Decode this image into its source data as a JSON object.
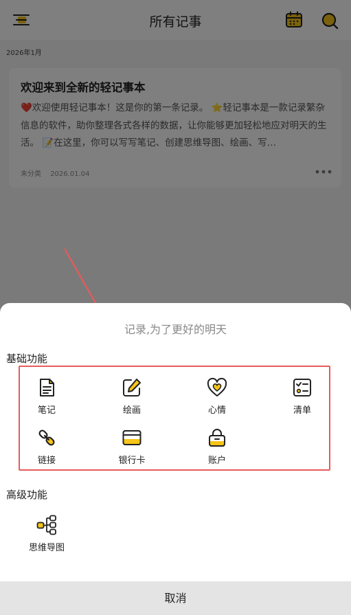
{
  "header": {
    "title": "所有记事",
    "menu_icon": "menu-icon",
    "calendar_icon": "calendar-icon",
    "search_icon": "search-icon"
  },
  "list": {
    "month": "2026年1月",
    "note": {
      "title": "欢迎来到全新的轻记事本",
      "body": "❤️欢迎使用轻记事本！这是你的第一条记录。 ⭐轻记事本是一款记录繁杂信息的软件，助你整理各式各样的数据，让你能够更加轻松地应对明天的生活。 📝在这里，你可以写写笔记、创建思维导图、绘画、写…",
      "category": "未分类",
      "date": "2026.01.04"
    }
  },
  "sheet": {
    "title": "记录,为了更好的明天",
    "basic_label": "基础功能",
    "basic_items": [
      {
        "label": "笔记",
        "icon": "note-icon"
      },
      {
        "label": "绘画",
        "icon": "draw-icon"
      },
      {
        "label": "心情",
        "icon": "mood-icon"
      },
      {
        "label": "清单",
        "icon": "checklist-icon"
      },
      {
        "label": "链接",
        "icon": "link-icon"
      },
      {
        "label": "银行卡",
        "icon": "bank-card-icon"
      },
      {
        "label": "账户",
        "icon": "account-icon"
      }
    ],
    "advanced_label": "高级功能",
    "advanced_items": [
      {
        "label": "思维导图",
        "icon": "mindmap-icon"
      }
    ],
    "cancel_label": "取消"
  },
  "colors": {
    "accent": "#f5c518",
    "annotation": "#e85a5a",
    "dim_overlay": "rgba(0,0,0,0.5)"
  }
}
